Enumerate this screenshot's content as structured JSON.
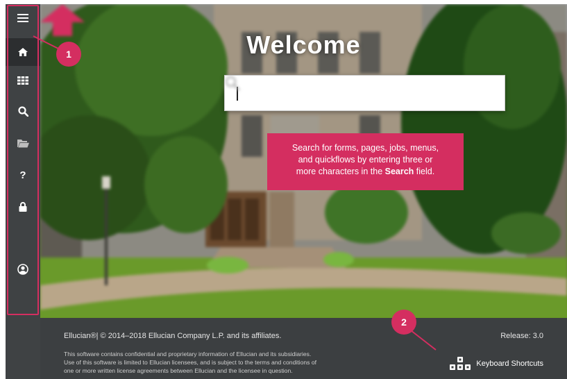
{
  "sidebar": {
    "items": [
      {
        "id": "menu",
        "icon": "hamburger-menu-icon"
      },
      {
        "id": "home",
        "icon": "home-icon",
        "active": true
      },
      {
        "id": "applications",
        "icon": "grid-icon"
      },
      {
        "id": "search",
        "icon": "search-icon"
      },
      {
        "id": "recent",
        "icon": "folder-icon"
      },
      {
        "id": "help",
        "icon": "question-icon"
      },
      {
        "id": "sign-out",
        "icon": "lock-icon"
      },
      {
        "id": "user",
        "icon": "user-icon"
      }
    ]
  },
  "main": {
    "title": "Welcome",
    "search": {
      "value": "",
      "placeholder": ""
    }
  },
  "callout": {
    "line1": "Search for forms, pages, jobs, menus,",
    "line2": "and quickflows by entering three or",
    "line3_pre": "more characters in the ",
    "line3_bold": "Search",
    "line3_post": " field."
  },
  "badges": {
    "one": "1",
    "two": "2"
  },
  "footer": {
    "copyright": "Ellucian®| © 2014–2018 Ellucian Company L.P. and its affiliates.",
    "release": "Release: 3.0",
    "legal": [
      "This software contains confidential and proprietary information of Ellucian and its subsidiaries.",
      "Use of this software is limited to Ellucian licensees, and is subject to the terms and conditions of",
      "one or more written license agreements between Ellucian and the licensee in question."
    ],
    "keyboard_shortcuts": "Keyboard Shortcuts"
  },
  "colors": {
    "accent": "#d42e60",
    "sidebar": "#3f4244",
    "footer": "#3c3f41"
  }
}
